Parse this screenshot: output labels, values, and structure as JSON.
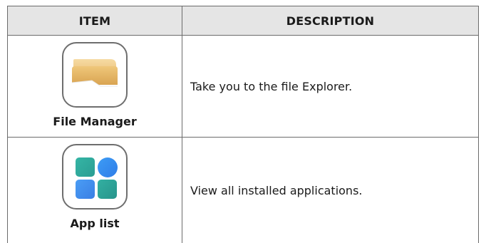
{
  "table": {
    "header": {
      "item": "ITEM",
      "description": "DESCRIPTION"
    },
    "rows": [
      {
        "icon": "folder-icon",
        "label": "File Manager",
        "description": "Take you to the file Explorer."
      },
      {
        "icon": "app-grid-icon",
        "label": "App list",
        "description": "View all installed applications."
      }
    ]
  },
  "colors": {
    "header_bg": "#e5e5e5",
    "border": "#6b6b6b",
    "folder": "#e2b25c",
    "app_teal": "#33b0a2",
    "app_blue": "#3d9cf5"
  }
}
